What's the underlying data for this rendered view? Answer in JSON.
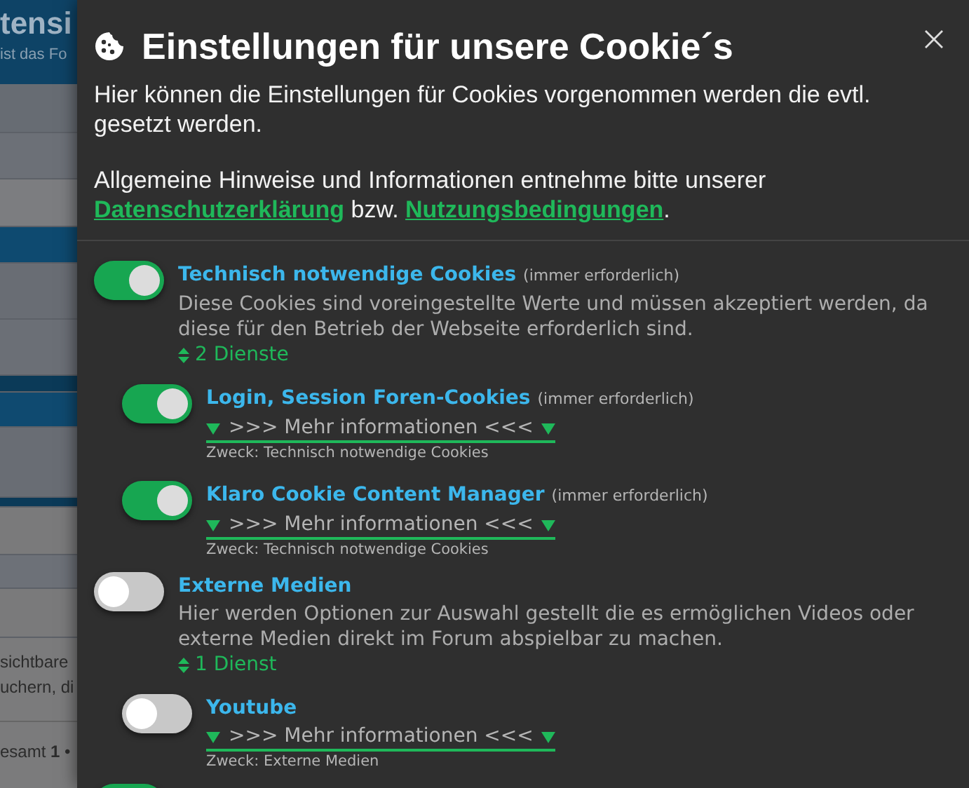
{
  "background_page": {
    "header_title": "tensi",
    "header_subtitle": "ist das Fo",
    "text_lines": [
      "sichtbare",
      "uchern, di"
    ],
    "footer_text": "esamt **1** •"
  },
  "dialog": {
    "title": "Einstellungen für unsere Cookie´s",
    "intro": "Hier können die Einstellungen für Cookies vorgenommen werden die evtl. gesetzt werden.",
    "notice": "Allgemeine Hinweise und Informationen entnehme bitte unserer",
    "links": [
      {
        "label": "Datenschutzerklärung"
      },
      {
        "label": "Nutzungsbedingungen"
      }
    ],
    "link_separator": "bzw.",
    "link_end": ".",
    "categories": [
      {
        "title": "Technisch notwendige Cookies",
        "required_note": "(immer erforderlich)",
        "on": true,
        "description": "Diese Cookies sind voreingestellte Werte und müssen akzeptiert werden, da diese für den Betrieb der Webseite erforderlich sind.",
        "services_toggle": "2 Dienste",
        "services": [
          {
            "title": "Login, Session Foren-Cookies",
            "required_note": "(immer erforderlich)",
            "on": true,
            "more_link": ">>> Mehr informationen <<<",
            "purpose": "Zweck: Technisch notwendige Cookies"
          },
          {
            "title": "Klaro Cookie Content Manager",
            "required_note": "(immer erforderlich)",
            "on": true,
            "more_link": ">>> Mehr informationen <<<",
            "purpose": "Zweck: Technisch notwendige Cookies"
          }
        ]
      },
      {
        "title": "Externe Medien",
        "on": false,
        "description": "Hier werden Optionen zur Auswahl gestellt die es ermöglichen Videos oder externe Medien direkt im Forum abspielbar zu machen.",
        "services_toggle": "1 Dienst",
        "services": [
          {
            "title": "Youtube",
            "on": false,
            "more_link": ">>> Mehr informationen <<<",
            "purpose": "Zweck: Externe Medien"
          }
        ]
      },
      {
        "on": true
      }
    ]
  }
}
